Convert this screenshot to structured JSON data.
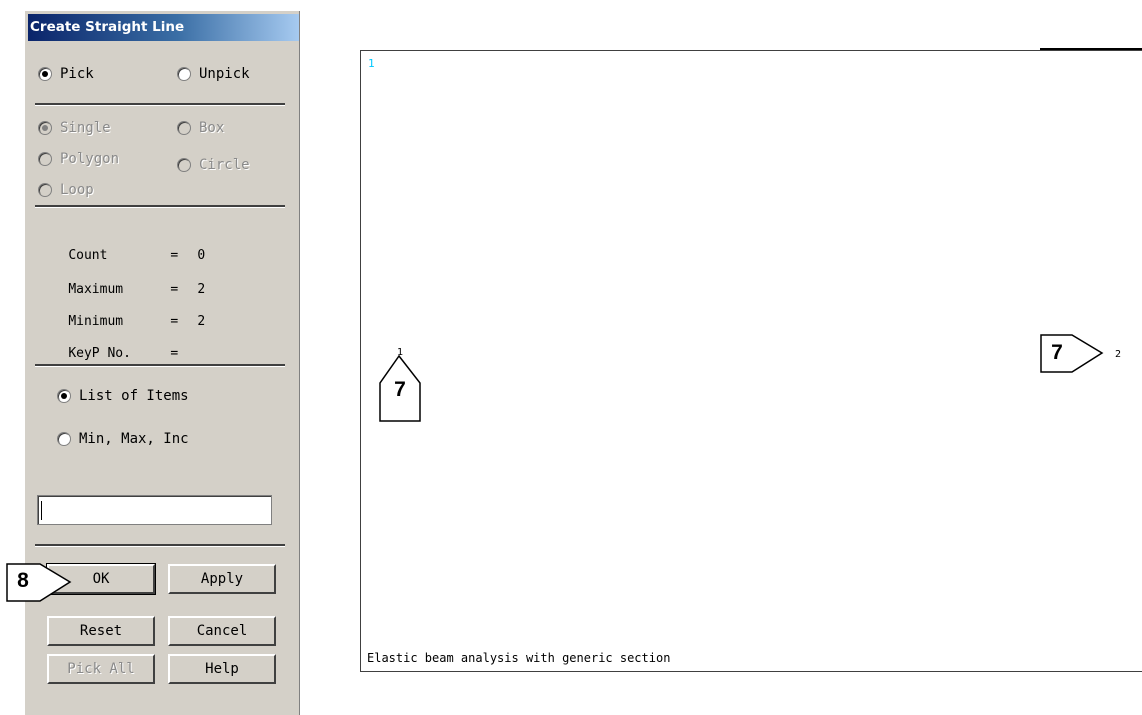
{
  "dialog": {
    "title": "Create Straight Line",
    "mode": {
      "pick": "Pick",
      "unpick": "Unpick",
      "selected": "Pick"
    },
    "pick_types": {
      "single": "Single",
      "box": "Box",
      "polygon": "Polygon",
      "circle": "Circle",
      "loop": "Loop",
      "selected": "Single",
      "enabled": false
    },
    "stats": {
      "count_label": "Count",
      "count_value": "0",
      "maximum_label": "Maximum",
      "maximum_value": "2",
      "minimum_label": "Minimum",
      "minimum_value": "2",
      "keyp_label": "KeyP No.",
      "keyp_value": "",
      "eq": "="
    },
    "entry_mode": {
      "list": "List of Items",
      "range": "Min, Max, Inc",
      "selected": "List of Items"
    },
    "input_value": "",
    "buttons": {
      "ok": "OK",
      "apply": "Apply",
      "reset": "Reset",
      "cancel": "Cancel",
      "pick_all": "Pick All",
      "help": "Help"
    }
  },
  "viewport": {
    "window_number": "1",
    "keypoints": [
      {
        "label": "1"
      },
      {
        "label": "2"
      }
    ],
    "title_text": "Elastic beam analysis with generic section"
  },
  "callouts": [
    {
      "step": "7",
      "target": "keypoint 1"
    },
    {
      "step": "7",
      "target": "keypoint 2"
    },
    {
      "step": "8",
      "target": "OK button"
    }
  ]
}
